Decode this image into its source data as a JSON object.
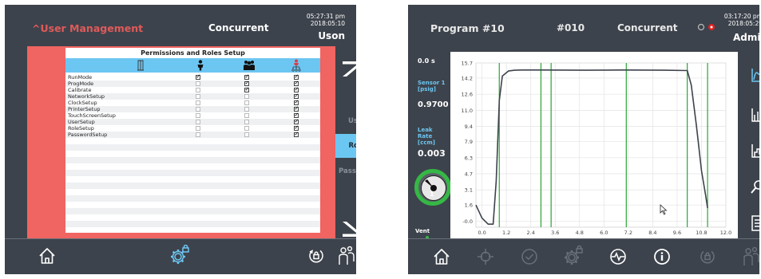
{
  "screen1": {
    "title": "^User Management",
    "center": "Concurrent",
    "time": "05:27:31 pm",
    "date": "2018:05:10",
    "user": "Uson",
    "table_title": "Permissions and Roles Setup",
    "rows": [
      {
        "name": "RunMode",
        "c": [
          true,
          true,
          true
        ]
      },
      {
        "name": "ProgMode",
        "c": [
          false,
          true,
          true
        ]
      },
      {
        "name": "Calibrate",
        "c": [
          false,
          true,
          true
        ]
      },
      {
        "name": "NetworkSetup",
        "c": [
          false,
          false,
          true
        ]
      },
      {
        "name": "ClockSetup",
        "c": [
          false,
          false,
          true
        ]
      },
      {
        "name": "PrinterSetup",
        "c": [
          false,
          false,
          true
        ]
      },
      {
        "name": "TouchScreenSetup",
        "c": [
          false,
          false,
          true
        ]
      },
      {
        "name": "UserSetup",
        "c": [
          false,
          false,
          true
        ]
      },
      {
        "name": "RoleSetup",
        "c": [
          false,
          false,
          true
        ]
      },
      {
        "name": "PasswordSetup",
        "c": [
          false,
          false,
          true
        ]
      }
    ],
    "side": {
      "users": "Users",
      "roles": "Roles",
      "passwords": "Passwords"
    }
  },
  "screen2": {
    "title": "Program #10",
    "num": "#010",
    "center": "Concurrent",
    "time": "03:17:20 pm",
    "date": "2018:05:29",
    "user": "Admin",
    "elapsed": "0.0 s",
    "sensor_label": "Sensor 1 [psig]",
    "sensor_value": "0.9700",
    "leak_label": "Leak Rate [ccm]",
    "leak_value": "0.003",
    "gauge_value": "1",
    "vent_label": "Vent"
  },
  "chart_data": {
    "type": "line",
    "x_ticks": [
      "0.0",
      "1.2",
      "2.4",
      "3.6",
      "4.8",
      "6.0",
      "7.2",
      "8.4",
      "9.6",
      "10.8",
      "12.0"
    ],
    "y_ticks": [
      "-0.0",
      "1.6",
      "3.1",
      "4.7",
      "6.3",
      "7.9",
      "9.4",
      "11.0",
      "12.6",
      "14.2",
      "15.7"
    ],
    "xlim": [
      -0.3,
      12.0
    ],
    "ylim": [
      -0.6,
      15.7
    ],
    "markers_x": [
      0.85,
      2.9,
      3.4,
      7.1,
      10.1,
      11.1
    ],
    "series": [
      {
        "x": [
          -0.3,
          0.0,
          0.3,
          0.55,
          0.7,
          0.85,
          1.0,
          1.3,
          1.6,
          2.0,
          3.0,
          5.0,
          7.0,
          9.0,
          10.1,
          10.3,
          10.55,
          10.8,
          11.0,
          11.1
        ],
        "y": [
          1.6,
          0.3,
          -0.3,
          -0.3,
          4.0,
          12.0,
          14.4,
          14.9,
          14.98,
          15.0,
          15.0,
          14.98,
          15.0,
          14.98,
          14.95,
          13.5,
          9.5,
          5.0,
          2.6,
          1.3
        ]
      }
    ],
    "line_color": "#3d434c",
    "marker_color": "#2aa533"
  }
}
